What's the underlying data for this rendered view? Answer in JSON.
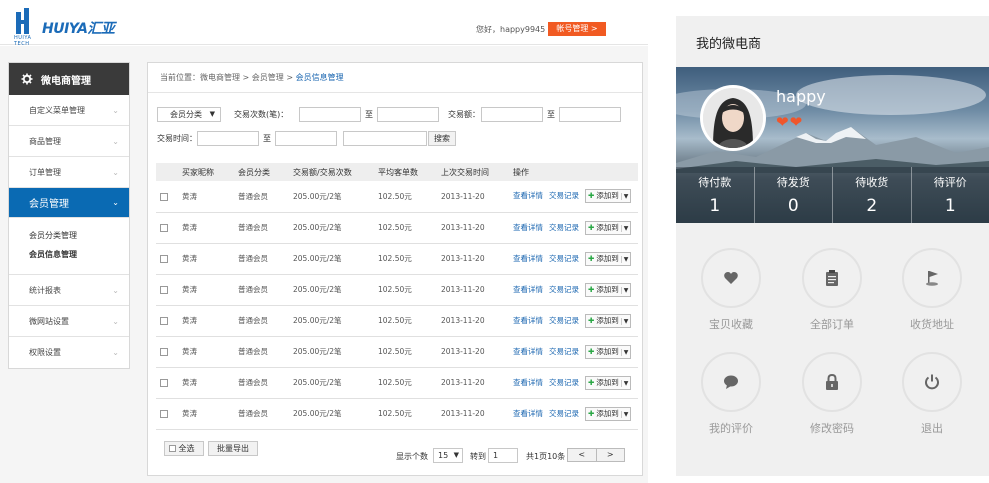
{
  "header": {
    "logo_sub": "HUIYA TECH",
    "logo_text": "HUIYA汇亚",
    "greeting": "您好，happy9945",
    "account_btn": "帐号管理 >"
  },
  "sidebar": {
    "title": "微电商管理",
    "items": [
      {
        "label": "自定义菜单管理"
      },
      {
        "label": "商品管理"
      },
      {
        "label": "订单管理"
      },
      {
        "label": "会员管理"
      },
      {
        "label": "统计报表"
      },
      {
        "label": "微网站设置"
      },
      {
        "label": "权限设置"
      }
    ],
    "sub_items": [
      {
        "label": "会员分类管理"
      },
      {
        "label": "会员信息管理"
      }
    ]
  },
  "breadcrumb": {
    "prefix": "当前位置：微电商管理 > 会员管理 > ",
    "current": "会员信息管理"
  },
  "filters": {
    "member_type": "会员分类",
    "trade_count_label": "交易次数(笔)：",
    "to1": "至",
    "trade_amount_label": "交易额：",
    "to2": "至",
    "trade_time_label": "交易时间：",
    "to3": "至",
    "search_btn": "搜索"
  },
  "table": {
    "headers": [
      "买家昵称",
      "会员分类",
      "交易额/交易次数",
      "平均客单数",
      "上次交易时间",
      "操作"
    ],
    "rows": [
      {
        "name": "黄涛",
        "type": "普通会员",
        "amount": "205.00元/2笔",
        "avg": "102.50元",
        "date": "2013-11-20"
      },
      {
        "name": "黄涛",
        "type": "普通会员",
        "amount": "205.00元/2笔",
        "avg": "102.50元",
        "date": "2013-11-20"
      },
      {
        "name": "黄涛",
        "type": "普通会员",
        "amount": "205.00元/2笔",
        "avg": "102.50元",
        "date": "2013-11-20"
      },
      {
        "name": "黄涛",
        "type": "普通会员",
        "amount": "205.00元/2笔",
        "avg": "102.50元",
        "date": "2013-11-20"
      },
      {
        "name": "黄涛",
        "type": "普通会员",
        "amount": "205.00元/2笔",
        "avg": "102.50元",
        "date": "2013-11-20"
      },
      {
        "name": "黄涛",
        "type": "普通会员",
        "amount": "205.00元/2笔",
        "avg": "102.50元",
        "date": "2013-11-20"
      },
      {
        "name": "黄涛",
        "type": "普通会员",
        "amount": "205.00元/2笔",
        "avg": "102.50元",
        "date": "2013-11-20"
      },
      {
        "name": "黄涛",
        "type": "普通会员",
        "amount": "205.00元/2笔",
        "avg": "102.50元",
        "date": "2013-11-20"
      }
    ],
    "view_link": "查看详情",
    "trade_link": "交易记录",
    "add_btn": "添加到"
  },
  "footer": {
    "select_all": "全选",
    "batch_export": "批量导出",
    "page_size_label": "显示个数",
    "page_size": "15",
    "goto_label": "转到",
    "goto_value": "1",
    "page_info": "共1页10条",
    "prev": "<",
    "next": ">"
  },
  "phone": {
    "title": "我的微电商",
    "username": "happy",
    "hearts": "❤❤",
    "stats": [
      {
        "label": "待付款",
        "count": "1"
      },
      {
        "label": "待发货",
        "count": "0"
      },
      {
        "label": "待收货",
        "count": "2"
      },
      {
        "label": "待评价",
        "count": "1"
      }
    ],
    "menu": [
      {
        "label": "宝贝收藏",
        "icon": "heart-icon"
      },
      {
        "label": "全部订单",
        "icon": "clipboard-icon"
      },
      {
        "label": "收货地址",
        "icon": "location-flag-icon"
      },
      {
        "label": "我的评价",
        "icon": "speech-bubble-icon"
      },
      {
        "label": "修改密码",
        "icon": "lock-icon"
      },
      {
        "label": "退出",
        "icon": "power-icon"
      }
    ]
  }
}
